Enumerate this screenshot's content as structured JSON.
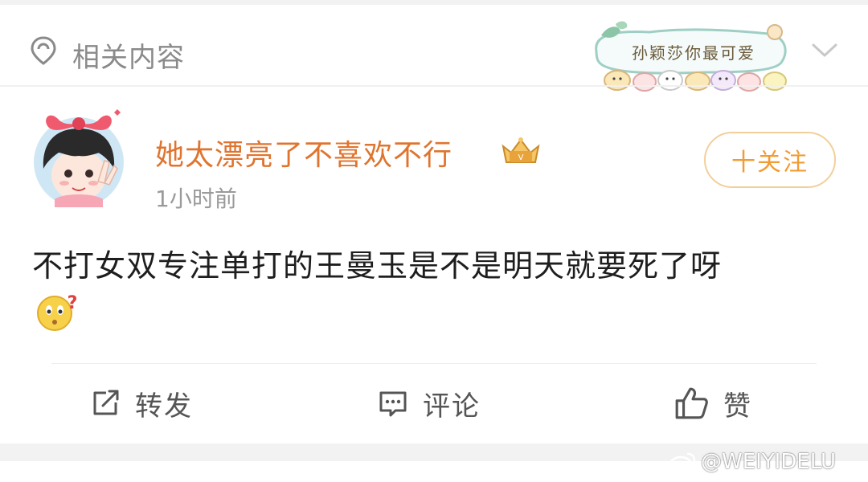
{
  "section": {
    "title": "相关内容",
    "sticker_text": "孙颖莎你最可爱"
  },
  "post": {
    "username": "她太漂亮了不喜欢不行",
    "time": "1小时前",
    "follow_label": "十关注",
    "text": "不打女双专注单打的王曼玉是不是明天就要死了呀"
  },
  "actions": {
    "repost": "转发",
    "comment": "评论",
    "like": "赞"
  },
  "watermark": "@WEIYIDELU",
  "colors": {
    "username": "#e0742e",
    "follow": "#f19c33",
    "muted": "#9a9a9a"
  },
  "icons": [
    "location-pin-icon",
    "chevron-down-icon",
    "vip-crown-icon",
    "question-emoji-icon",
    "repost-icon",
    "comment-icon",
    "thumbs-up-icon",
    "weibo-icon"
  ]
}
